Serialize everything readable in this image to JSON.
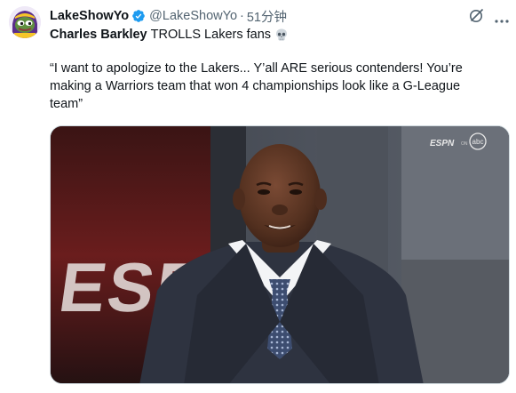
{
  "tweet": {
    "display_name": "LakeShowYo",
    "handle": "@LakeShowYo",
    "separator": "·",
    "time": "51分钟",
    "headline_bold": "Charles Barkley",
    "headline_rest": "TROLLS Lakers fans",
    "quote_lines": [
      "“I want to apologize to the Lakers... Y’all ARE serious contenders! You’re",
      "making a Warriors team that won 4 championships look like a G-League",
      "team”"
    ],
    "media": {
      "set_logo_text": "ESPN",
      "bug_network": "ESPN",
      "bug_partner": "abc"
    },
    "icons": {
      "verified": "verified-badge-icon",
      "grok": "grok-icon",
      "more": "more-icon",
      "skull": "skull-emoji"
    },
    "colors": {
      "text": "#0f1419",
      "secondary": "#536471",
      "verified": "#1d9bf0"
    }
  }
}
